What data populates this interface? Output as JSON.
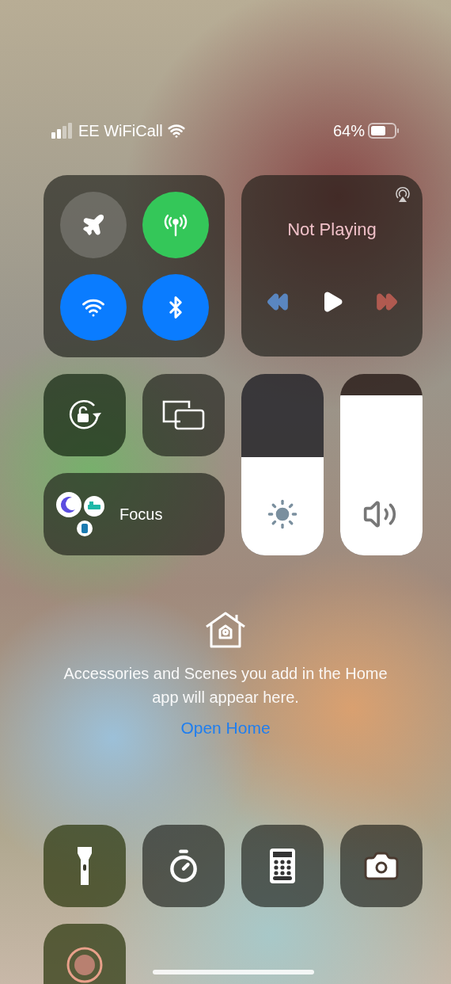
{
  "status_bar": {
    "carrier": "EE WiFiCall",
    "battery": "64%"
  },
  "connectivity": [
    {
      "kind": "airplane",
      "on": false
    },
    {
      "kind": "cellular",
      "on": true
    },
    {
      "kind": "wifi",
      "on": true
    },
    {
      "kind": "bluetooth",
      "on": true
    }
  ],
  "media": {
    "title": "Not Playing"
  },
  "orientation_lock": {
    "on": false
  },
  "focus": {
    "label": "Focus"
  },
  "brightness": {
    "level": 0.54
  },
  "volume": {
    "level": 0.88
  },
  "home": {
    "message": "Accessories and Scenes you add in the Home app will appear here.",
    "link": "Open Home"
  },
  "shortcuts": [
    {
      "kind": "flashlight"
    },
    {
      "kind": "timer"
    },
    {
      "kind": "calculator"
    },
    {
      "kind": "camera"
    },
    {
      "kind": "screen-recording"
    }
  ]
}
